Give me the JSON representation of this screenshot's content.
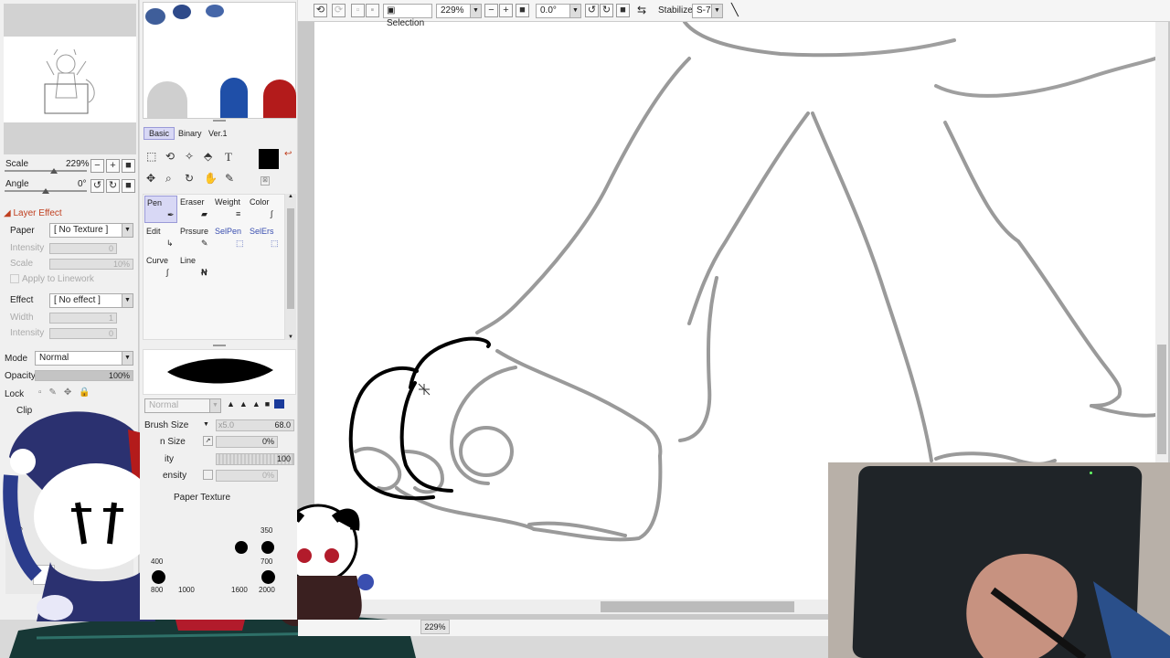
{
  "toolbar": {
    "selection_label": "Selection",
    "zoom_value": "229%",
    "angle_value": "0.0°",
    "stabilizer_label": "Stabilizer",
    "stabilizer_value": "S-7"
  },
  "navigator": {
    "scale_label": "Scale",
    "scale_value": "229%",
    "angle_label": "Angle",
    "angle_value": "0°"
  },
  "layer_effect": {
    "header": "Layer Effect",
    "paper_label": "Paper",
    "paper_value": "[ No Texture ]",
    "intensity_label": "Intensity",
    "intensity_value": "0",
    "scale_label": "Scale",
    "scale_value": "10%",
    "apply_linework": "Apply to Linework",
    "effect_label": "Effect",
    "effect_value": "[ No effect ]",
    "width_label": "Width",
    "width_value": "1",
    "intensity2_label": "Intensity",
    "intensity2_value": "0"
  },
  "layer": {
    "mode_label": "Mode",
    "mode_value": "Normal",
    "opacity_label": "Opacity",
    "opacity_value": "100%",
    "lock_label": "Lock",
    "clipping_label": "Clip"
  },
  "brush_tabs": [
    "Basic",
    "Binary",
    "Ver.1"
  ],
  "tools": {
    "pen": "Pen",
    "eraser": "Eraser",
    "weight": "Weight",
    "color": "Color",
    "edit": "Edit",
    "pressure": "Prssure",
    "selpen": "SelPen",
    "selers": "SelErs",
    "curve": "Curve",
    "line": "Line"
  },
  "brush": {
    "blend_mode": "Normal",
    "size_label": "Brush Size",
    "size_multiplier": "x5.0",
    "size_value": "68.0",
    "min_size_label": "n Size",
    "min_size_value": "0%",
    "density_label": "ity",
    "density_value": "100",
    "intensity_label": "ensity",
    "intensity_value": "0%",
    "paper_texture": "Paper Texture",
    "sizes_row1": [
      "350"
    ],
    "sizes_row2": [
      "400",
      "700"
    ],
    "sizes_row3": [
      "800",
      "1000",
      "1600",
      "2000"
    ]
  },
  "status": {
    "zoom": "229%"
  },
  "colors": {
    "swatch1": "#3f5e9a",
    "swatch2": "#2e4a8a",
    "swatch3": "#4566a8",
    "primary": "#000000",
    "blue_mark": "#1f4fa8",
    "red_mark": "#b31b1b",
    "grey_mark": "#cfcfcf"
  }
}
